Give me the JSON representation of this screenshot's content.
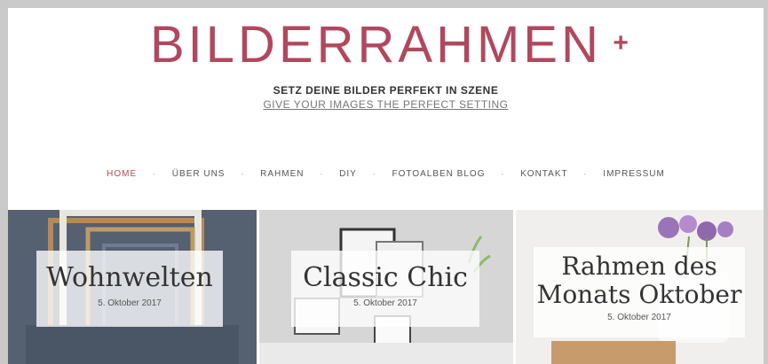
{
  "site": {
    "logo": "BILDERRAHMEN",
    "logo_plus": "+",
    "tagline_de": "SETZ DEINE BILDER PERFEKT IN SZENE",
    "tagline_en": "GIVE YOUR IMAGES THE PERFECT SETTING",
    "accent_color": "#b0485e"
  },
  "nav": {
    "items": [
      {
        "label": "HOME",
        "active": true
      },
      {
        "label": "ÜBER UNS"
      },
      {
        "label": "RAHMEN"
      },
      {
        "label": "DIY"
      },
      {
        "label": "FOTOALBEN BLOG"
      },
      {
        "label": "KONTAKT"
      },
      {
        "label": "IMPRESSUM"
      }
    ],
    "separator": "-"
  },
  "posts": [
    {
      "title": "Wohnwelten",
      "date": "5. Oktober 2017"
    },
    {
      "title": "Classic Chic",
      "date": "5. Oktober 2017"
    },
    {
      "title": "Rahmen des Monats Oktober",
      "date": "5. Oktober 2017"
    }
  ]
}
